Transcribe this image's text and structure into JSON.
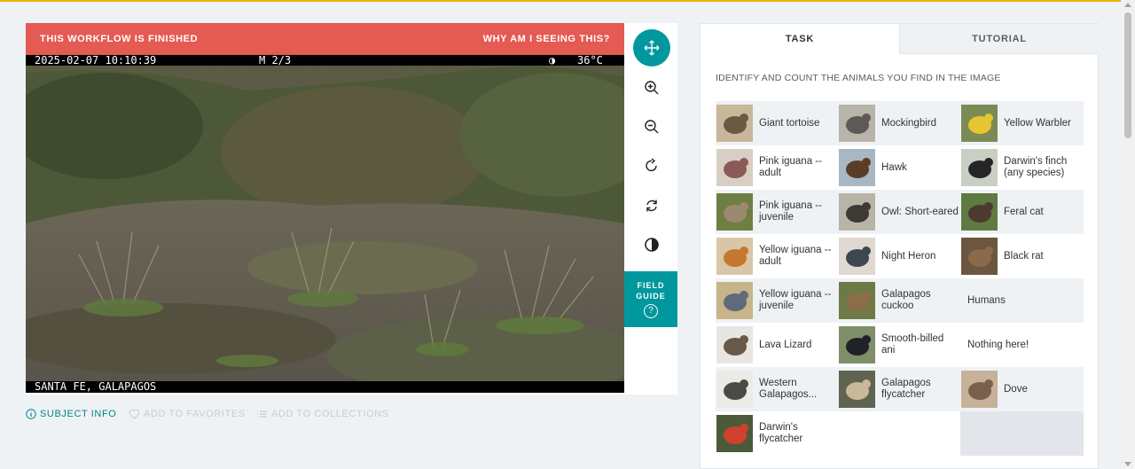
{
  "viewer": {
    "banner_left": "THIS WORKFLOW IS FINISHED",
    "banner_right": "WHY AM I SEEING THIS?",
    "cam_timestamp": "2025-02-07 10:10:39",
    "cam_frame": "M 2/3",
    "cam_moon": "◑",
    "cam_temp": "36°C",
    "cam_location": "SANTA FE, GALAPAGOS",
    "field_guide_label": "FIELD GUIDE",
    "field_guide_q": "?"
  },
  "meta_links": {
    "subject_info": "SUBJECT INFO",
    "add_favorites": "ADD TO FAVORITES",
    "add_collections": "ADD TO COLLECTIONS"
  },
  "tabs": {
    "task": "TASK",
    "tutorial": "TUTORIAL"
  },
  "task": {
    "instruction": "IDENTIFY AND COUNT THE ANIMALS YOU FIND IN THE IMAGE",
    "choices": [
      {
        "label": "Giant tortoise",
        "icon": "tortoise"
      },
      {
        "label": "Mockingbird",
        "icon": "mockingbird"
      },
      {
        "label": "Yellow Warbler",
        "icon": "warbler"
      },
      {
        "label": "Pink iguana -- adult",
        "icon": "pink-iguana"
      },
      {
        "label": "Hawk",
        "icon": "hawk"
      },
      {
        "label": "Darwin's finch (any species)",
        "icon": "finch"
      },
      {
        "label": "Pink iguana -- juvenile",
        "icon": "pink-iguana-juvenile"
      },
      {
        "label": "Owl: Short-eared",
        "icon": "owl"
      },
      {
        "label": "Feral cat",
        "icon": "cat"
      },
      {
        "label": "Yellow iguana -- adult",
        "icon": "yellow-iguana"
      },
      {
        "label": "Night Heron",
        "icon": "heron"
      },
      {
        "label": "Black rat",
        "icon": "rat"
      },
      {
        "label": "Yellow iguana -- juvenile",
        "icon": "yellow-iguana-juvenile"
      },
      {
        "label": "Galapagos cuckoo",
        "icon": "cuckoo"
      },
      {
        "label": "Humans",
        "icon": ""
      },
      {
        "label": "Lava Lizard",
        "icon": "lava-lizard"
      },
      {
        "label": "Smooth-billed ani",
        "icon": "ani"
      },
      {
        "label": "Nothing here!",
        "icon": ""
      },
      {
        "label": "Western Galapagos...",
        "icon": "snake"
      },
      {
        "label": "Galapagos flycatcher",
        "icon": "flycatcher"
      },
      {
        "label": "Dove",
        "icon": "dove"
      },
      {
        "label": "Darwin's flycatcher",
        "icon": "red-flycatcher"
      }
    ]
  }
}
